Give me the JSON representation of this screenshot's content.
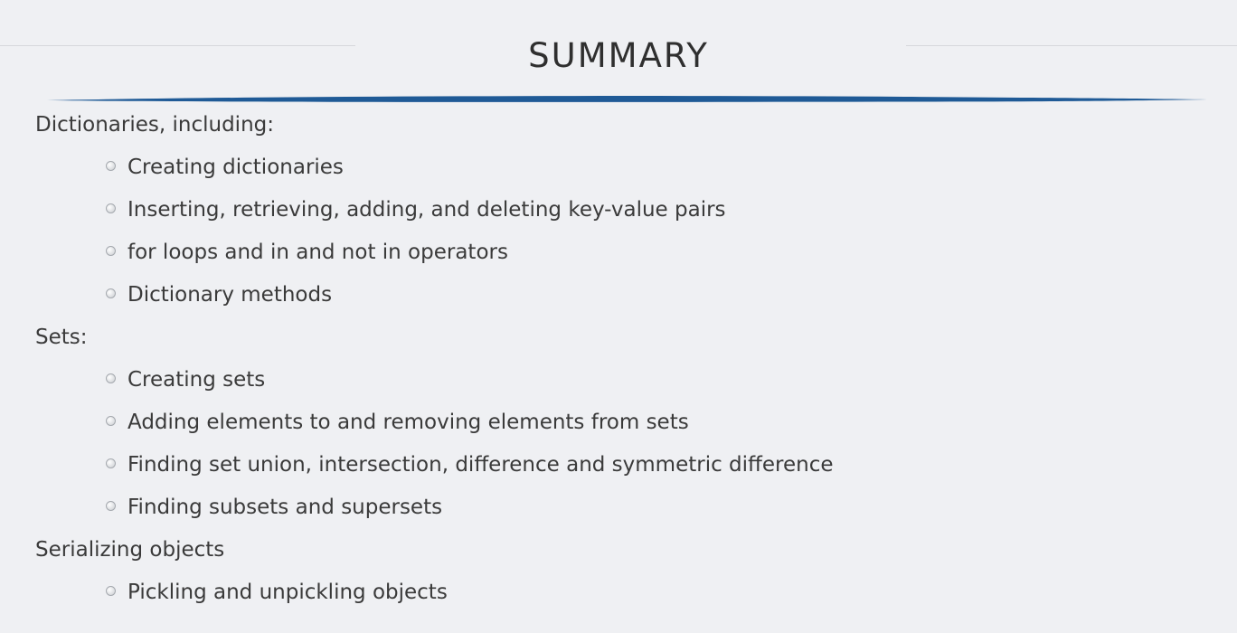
{
  "slide": {
    "title": "SUMMARY",
    "sections": [
      {
        "heading": "Dictionaries, including:",
        "items": [
          "Creating dictionaries",
          "Inserting, retrieving, adding, and deleting key-value pairs",
          "for loops and in and not in operators",
          "Dictionary methods"
        ]
      },
      {
        "heading": "Sets:",
        "items": [
          "Creating sets",
          "Adding elements to and removing elements from sets",
          "Finding set union, intersection, difference and symmetric difference",
          "Finding subsets and supersets"
        ]
      },
      {
        "heading": "Serializing objects",
        "items": [
          "Pickling and unpickling objects"
        ]
      }
    ]
  },
  "colors": {
    "background": "#eff0f3",
    "accent": "#1f5a96",
    "text": "#3a3a3a"
  }
}
